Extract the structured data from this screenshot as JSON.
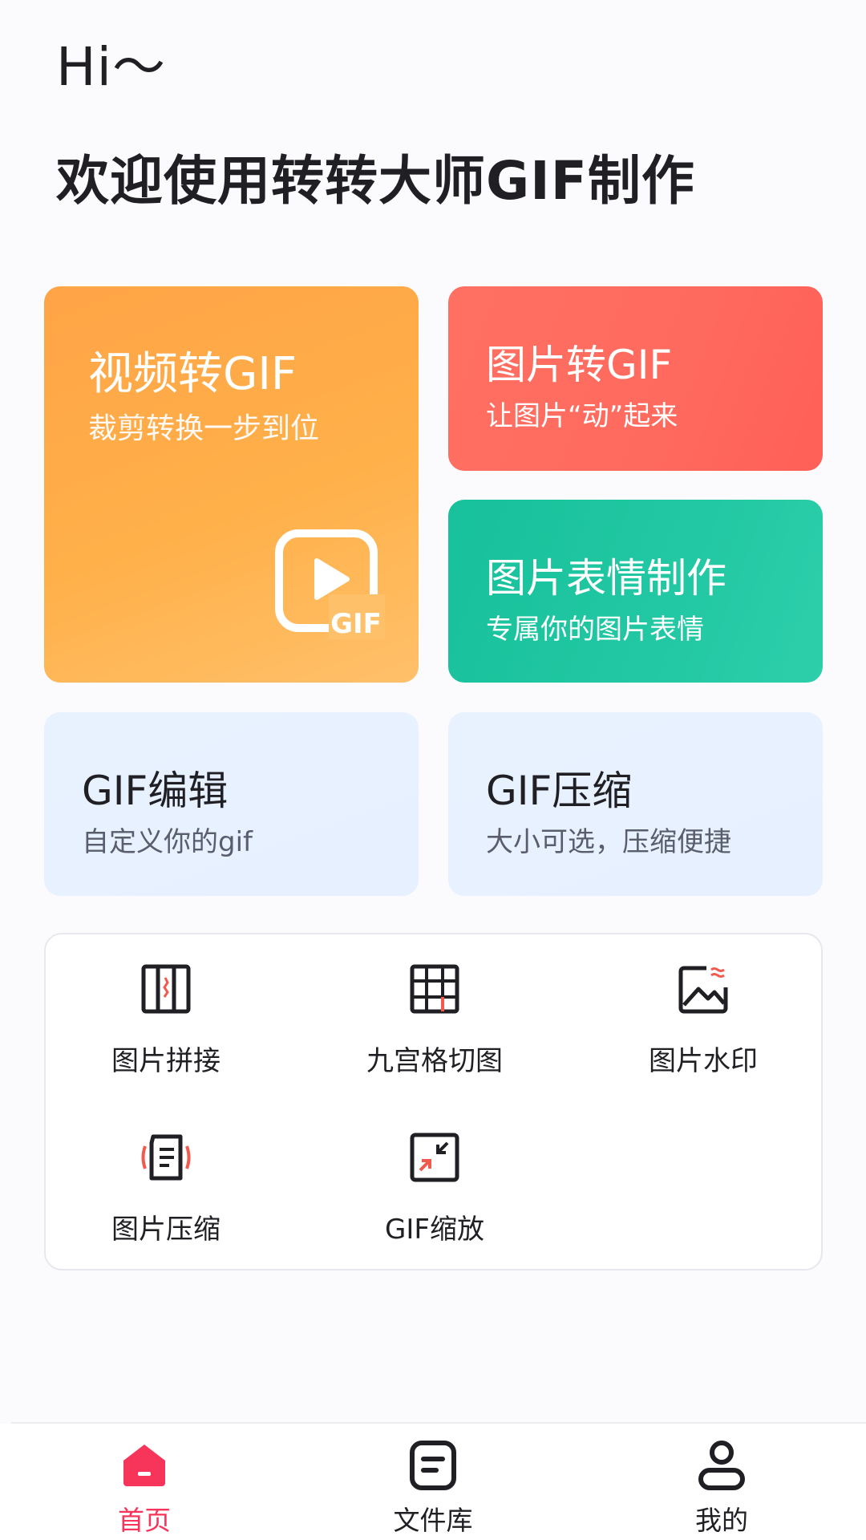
{
  "header": {
    "greeting": "Hi～",
    "welcome": "欢迎使用转转大师GIF制作"
  },
  "cards": {
    "video_to_gif": {
      "title": "视频转GIF",
      "subtitle": "裁剪转换一步到位",
      "icon_text": "GIF"
    },
    "image_to_gif": {
      "title": "图片转GIF",
      "subtitle": "让图片“动”起来"
    },
    "emoji_maker": {
      "title": "图片表情制作",
      "subtitle": "专属你的图片表情"
    },
    "gif_edit": {
      "title": "GIF编辑",
      "subtitle": "自定义你的gif"
    },
    "gif_compress": {
      "title": "GIF压缩",
      "subtitle": "大小可选，压缩便捷"
    }
  },
  "tools": [
    {
      "label": "图片拼接",
      "icon": "image-stitch-icon"
    },
    {
      "label": "九宫格切图",
      "icon": "grid-cut-icon"
    },
    {
      "label": "图片水印",
      "icon": "image-watermark-icon"
    },
    {
      "label": "图片压缩",
      "icon": "image-compress-icon"
    },
    {
      "label": "GIF缩放",
      "icon": "gif-scale-icon"
    }
  ],
  "tabbar": {
    "items": [
      {
        "label": "首页",
        "icon": "home-icon",
        "active": true
      },
      {
        "label": "文件库",
        "icon": "file-library-icon",
        "active": false
      },
      {
        "label": "我的",
        "icon": "profile-icon",
        "active": false
      }
    ]
  },
  "colors": {
    "accent_red": "#f7345a",
    "orange_card": "#ffa447",
    "red_card": "#ff6a5e",
    "green_card": "#22c8a3",
    "light_card": "#e7f1ff"
  }
}
